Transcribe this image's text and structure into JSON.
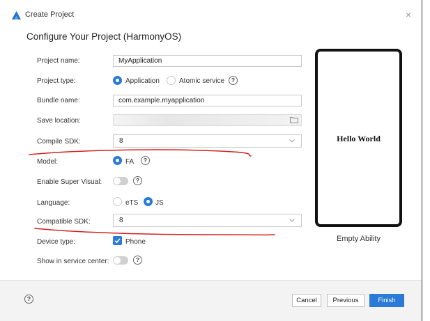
{
  "window": {
    "title": "Create Project",
    "close_glyph": "×"
  },
  "heading": "Configure Your Project (HarmonyOS)",
  "form": {
    "project_name": {
      "label": "Project name:",
      "value": "MyApplication"
    },
    "project_type": {
      "label": "Project type:",
      "options": [
        "Application",
        "Atomic service"
      ],
      "selected": "Application"
    },
    "bundle_name": {
      "label": "Bundle name:",
      "value": "com.example.myapplication"
    },
    "save_location": {
      "label": "Save location:",
      "value": ""
    },
    "compile_sdk": {
      "label": "Compile SDK:",
      "value": "8"
    },
    "model": {
      "label": "Model:",
      "options": [
        "FA"
      ],
      "selected": "FA"
    },
    "super_visual": {
      "label": "Enable Super Visual:",
      "enabled": false
    },
    "language": {
      "label": "Language:",
      "options": [
        "eTS",
        "JS"
      ],
      "selected": "JS"
    },
    "compatible_sdk": {
      "label": "Compatible SDK:",
      "value": "8"
    },
    "device_type": {
      "label": "Device type:",
      "option": "Phone",
      "checked": true
    },
    "service_center": {
      "label": "Show in service center:",
      "enabled": false
    },
    "help_glyph": "?"
  },
  "preview": {
    "text": "Hello World",
    "template": "Empty Ability"
  },
  "footer": {
    "cancel": "Cancel",
    "previous": "Previous",
    "finish": "Finish"
  },
  "colors": {
    "accent": "#2a7ad8",
    "annotation": "#d42020"
  },
  "icons": [
    "harmony-logo-icon",
    "close-icon",
    "folder-icon",
    "chevron-down-icon",
    "help-icon"
  ]
}
